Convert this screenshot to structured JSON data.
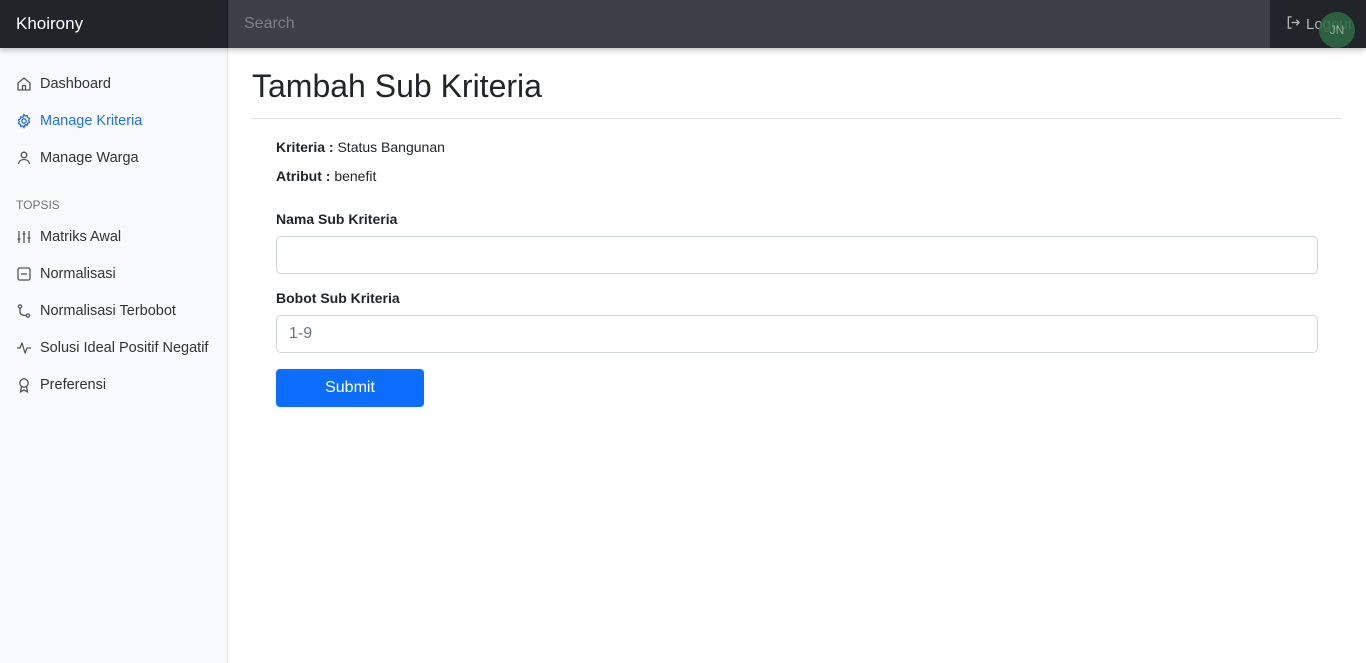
{
  "navbar": {
    "brand": "Khoirony",
    "search_placeholder": "Search",
    "logout_label": "Logout",
    "user_initials": "JN"
  },
  "sidebar": {
    "items": [
      {
        "label": "Dashboard",
        "icon": "home-icon",
        "active": false
      },
      {
        "label": "Manage Kriteria",
        "icon": "gear-icon",
        "active": true
      },
      {
        "label": "Manage Warga",
        "icon": "user-icon",
        "active": false
      }
    ],
    "section_heading": "TOPSIS",
    "topsis_items": [
      {
        "label": "Matriks Awal",
        "icon": "sliders-icon"
      },
      {
        "label": "Normalisasi",
        "icon": "minus-square-icon"
      },
      {
        "label": "Normalisasi Terbobot",
        "icon": "git-branch-icon"
      },
      {
        "label": "Solusi Ideal Positif Negatif",
        "icon": "activity-icon"
      },
      {
        "label": "Preferensi",
        "icon": "award-icon"
      }
    ]
  },
  "main": {
    "title": "Tambah Sub Kriteria",
    "kriteria_label": "Kriteria :",
    "kriteria_value": "Status Bangunan",
    "atribut_label": "Atribut :",
    "atribut_value": "benefit",
    "nama_label": "Nama Sub Kriteria",
    "nama_value": "",
    "bobot_label": "Bobot Sub Kriteria",
    "bobot_placeholder": "1-9",
    "submit_label": "Submit"
  },
  "colors": {
    "navbar": "#343a40",
    "brand_bg": "#212529",
    "sidebar_bg": "#f8f9fa",
    "active_link": "#2470dc",
    "primary_button": "#0d6efd"
  }
}
